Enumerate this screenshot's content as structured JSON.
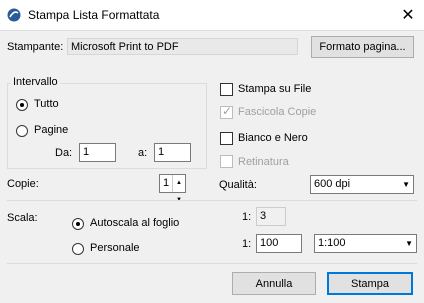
{
  "window": {
    "title": "Stampa Lista Formattata"
  },
  "printer": {
    "label": "Stampante:",
    "value": "Microsoft Print to PDF",
    "format_button": "Formato pagina..."
  },
  "range": {
    "title": "Intervallo",
    "all_label": "Tutto",
    "pages_label": "Pagine",
    "from_label": "Da:",
    "from_value": "1",
    "to_label": "a:",
    "to_value": "1"
  },
  "options": {
    "print_to_file": "Stampa su File",
    "collate": "Fascicola Copie",
    "black_white": "Bianco e Nero",
    "hatching": "Retinatura"
  },
  "copies": {
    "label": "Copie:",
    "value": "1"
  },
  "quality": {
    "label": "Qualità:",
    "value": "600 dpi"
  },
  "scale": {
    "label": "Scala:",
    "fit_label": "Autoscala al foglio",
    "custom_label": "Personale",
    "ratio_fit_label": "1:",
    "ratio_fit_value": "3",
    "ratio_custom_label": "1:",
    "ratio_custom_value": "100",
    "ratio_preset": "1:100"
  },
  "footer": {
    "cancel": "Annulla",
    "print": "Stampa"
  }
}
